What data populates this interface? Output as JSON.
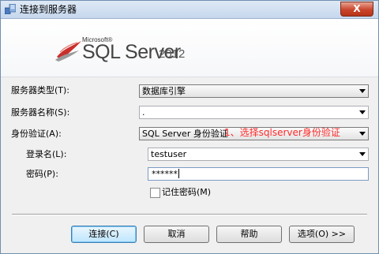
{
  "window": {
    "title": "连接到服务器",
    "close_symbol": "X"
  },
  "banner": {
    "microsoft": "Microsoft®",
    "product": "SQL Server",
    "year": "2012"
  },
  "form": {
    "server_type": {
      "label": "服务器类型(T):",
      "value": "数据库引擎"
    },
    "server_name": {
      "label": "服务器名称(S):",
      "value": "."
    },
    "auth": {
      "label": "身份验证(A):",
      "value": "SQL Server 身份验证"
    },
    "login": {
      "label": "登录名(L):",
      "value": "testuser"
    },
    "password": {
      "label": "密码(P):",
      "value": "******"
    },
    "remember": {
      "label": "记住密码(M)",
      "checked": false
    }
  },
  "annotation": "1、选择sqlserver身份验证",
  "buttons": {
    "connect": "连接(C)",
    "cancel": "取消",
    "help": "帮助",
    "options": "选项(O) >>"
  }
}
